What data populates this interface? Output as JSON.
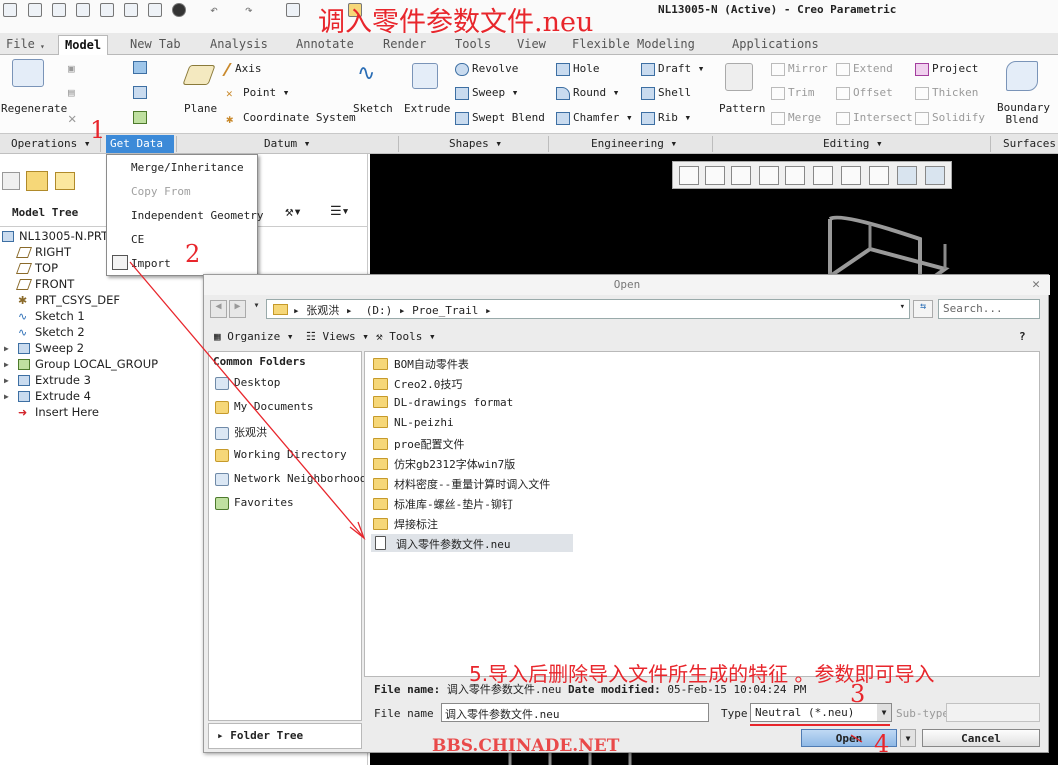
{
  "window": {
    "title": "NL13005-N (Active) - Creo Parametric",
    "overlay_title": "调入零件参数文件.neu"
  },
  "menu_tabs": [
    "File",
    "Model",
    "New Tab",
    "Analysis",
    "Annotate",
    "Render",
    "Tools",
    "View",
    "Flexible Modeling",
    "Applications"
  ],
  "ribbon": {
    "regenerate": "Regenerate",
    "plane": "Plane",
    "axis": "Axis",
    "point": "Point",
    "coordinate_system": "Coordinate System",
    "sketch": "Sketch",
    "extrude": "Extrude",
    "revolve": "Revolve",
    "sweep": "Sweep",
    "swept_blend": "Swept Blend",
    "hole": "Hole",
    "round": "Round",
    "chamfer": "Chamfer",
    "draft": "Draft",
    "shell": "Shell",
    "rib": "Rib",
    "pattern": "Pattern",
    "mirror": "Mirror",
    "trim": "Trim",
    "merge": "Merge",
    "extend": "Extend",
    "offset": "Offset",
    "intersect": "Intersect",
    "project": "Project",
    "thicken": "Thicken",
    "solidify": "Solidify",
    "boundary_blend": "Boundary Blend"
  },
  "groups": {
    "operations": "Operations",
    "get_data": "Get Data",
    "datum": "Datum",
    "shapes": "Shapes",
    "engineering": "Engineering",
    "editing": "Editing",
    "surfaces": "Surfaces"
  },
  "get_data_menu": [
    "Merge/Inheritance",
    "Copy From",
    "Independent Geometry",
    "CE",
    "Import"
  ],
  "model_tree": {
    "title": "Model Tree",
    "items": [
      "NL13005-N.PRT",
      "RIGHT",
      "TOP",
      "FRONT",
      "PRT_CSYS_DEF",
      "Sketch 1",
      "Sketch 2",
      "Sweep 2",
      "Group LOCAL_GROUP",
      "Extrude 3",
      "Extrude 4",
      "Insert Here"
    ]
  },
  "dialog": {
    "title": "Open",
    "path": [
      "张观洪",
      "(D:)",
      "Proe_Trail"
    ],
    "search_placeholder": "Search...",
    "organize": "Organize",
    "views": "Views",
    "tools": "Tools",
    "common_folders_title": "Common Folders",
    "common_folders": [
      "Desktop",
      "My Documents",
      "张观洪",
      "Working Directory",
      "Network Neighborhood",
      "Favorites"
    ],
    "folder_tree": "Folder Tree",
    "files": [
      "BOM自动零件表",
      "Creo2.0技巧",
      "DL-drawings format",
      "NL-peizhi",
      "proe配置文件",
      "仿宋gb2312字体win7版",
      "材料密度--重量计算时调入文件",
      "标准库-螺丝-垫片-铆钉",
      "焊接标注",
      "调入零件参数文件.neu"
    ],
    "info_name_label": "File name:",
    "info_name_value": "调入零件参数文件.neu",
    "info_date_label": "Date modified:",
    "info_date_value": "05-Feb-15 10:04:24 PM",
    "file_name_label": "File name",
    "file_name_value": "调入零件参数文件.neu",
    "type_label": "Type",
    "type_value": "Neutral (*.neu)",
    "subtype_label": "Sub-type",
    "open_button": "Open",
    "cancel_button": "Cancel"
  },
  "annotations": {
    "step1": "1",
    "step2": "2",
    "step3": "3",
    "step4": "4",
    "instruction": "5.导入后删除导入文件所生成的特征 。参数即可导入",
    "watermark": "BBS.CHINADE.NET"
  },
  "colors": {
    "annotation_red": "#e8262c",
    "selection_blue": "#3c8ad8",
    "graphics_bg": "#000000"
  }
}
